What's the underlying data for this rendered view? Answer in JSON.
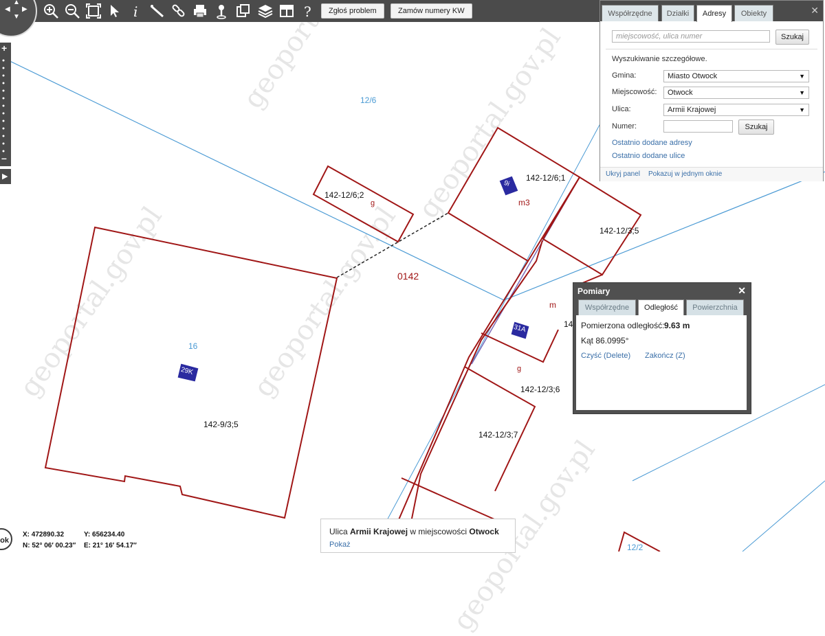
{
  "toolbar": {
    "buttons": [
      {
        "name": "nav-pan-control",
        "label": ""
      },
      {
        "name": "zoom-in-icon"
      },
      {
        "name": "zoom-out-icon"
      },
      {
        "name": "zoom-extent-icon"
      },
      {
        "name": "select-pointer-icon"
      },
      {
        "name": "info-icon"
      },
      {
        "name": "measure-ruler-icon"
      },
      {
        "name": "link-icon"
      },
      {
        "name": "print-icon"
      },
      {
        "name": "pin-icon"
      },
      {
        "name": "export-icon"
      },
      {
        "name": "layers-icon"
      },
      {
        "name": "layout-icon"
      },
      {
        "name": "help-icon"
      }
    ],
    "report_button": "Zgłoś problem",
    "order_button": "Zamów numery KW"
  },
  "search_panel": {
    "tabs": [
      "Współrzędne",
      "Działki",
      "Adresy",
      "Obiekty"
    ],
    "active_tab": "Adresy",
    "quick_search_placeholder": "miejscowość, ulica numer",
    "quick_search_button": "Szukaj",
    "detailed_heading": "Wyszukiwanie szczegółowe.",
    "fields": [
      {
        "label": "Gmina:",
        "value": "Miasto Otwock"
      },
      {
        "label": "Miejscowość:",
        "value": "Otwock"
      },
      {
        "label": "Ulica:",
        "value": "Armii Krajowej"
      }
    ],
    "number_label": "Numer:",
    "number_value": "",
    "number_search_button": "Szukaj",
    "recent_addresses_link": "Ostatnio dodane adresy",
    "recent_streets_link": "Ostatnio dodane ulice",
    "hide_panel_link": "Ukryj panel",
    "single_window_link": "Pokazuj w jednym oknie"
  },
  "measurements": {
    "title": "Pomiary",
    "tabs": [
      "Współrzędne",
      "Odległość",
      "Powierzchnia"
    ],
    "active_tab": "Odległość",
    "distance_label": "Pomierzona odległość:",
    "distance_value": "9.63 m",
    "angle_text": "Kąt 86.0995°",
    "clear_link": "Czyść (Delete)",
    "finish_link": "Zakończ (Z)"
  },
  "map_labels": {
    "parcel_12_6": "12/6",
    "parcel_142_12_6_2": "142-12/6;2",
    "parcel_142_12_6_1": "142-12/6;1",
    "parcel_142_12_3_5": "142-12/3;5",
    "parcel_142_12_3_6": "142-12/3;6",
    "parcel_142_12_3_7": "142-12/3;7",
    "parcel_142_9_3_5": "142-9/3;5",
    "parcel_16": "16",
    "parcel_12_2": "12/2",
    "region_0142": "0142",
    "partial_label": "14",
    "use_g_1": "g",
    "use_g_2": "g",
    "use_m3": "m3",
    "use_m": "m",
    "building_9i": "9i",
    "building_31a": "31A",
    "building_29k": "29K",
    "watermark": "geoportal.gov.pl"
  },
  "coordinates": {
    "x": "X: 472890.32",
    "y": "Y: 656234.40",
    "n": "N: 52° 06′ 00.23″",
    "e": "E: 21° 16′ 54.17″",
    "ok_label": "ok"
  },
  "address_popup": {
    "prefix": "Ulica ",
    "street": "Armii Krajowej",
    "middle": " w miejscowości ",
    "city": "Otwock",
    "show_link": "Pokaż"
  },
  "colors": {
    "parcel_border": "#a01616",
    "blue_line": "#4a9ad4",
    "building_fill": "#2a2aa0",
    "toolbar_bg": "#4b4b4b"
  }
}
